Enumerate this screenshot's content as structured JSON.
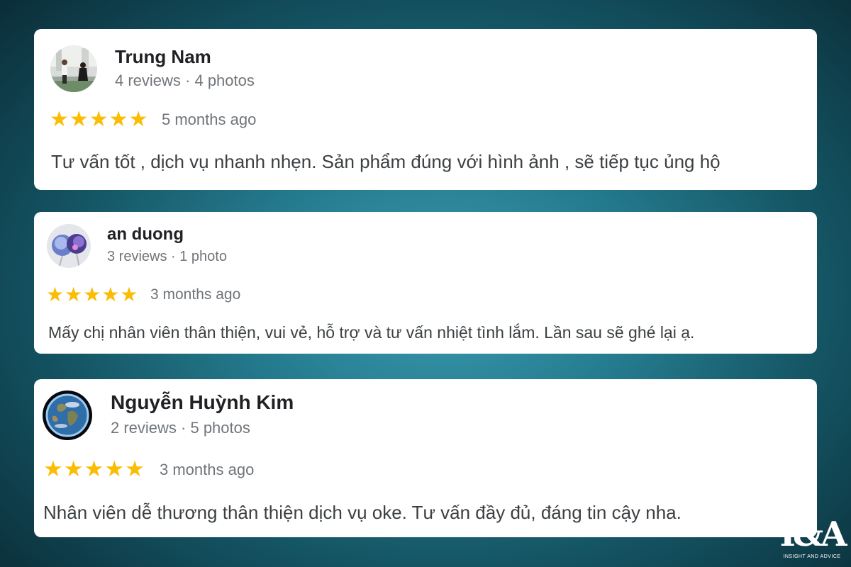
{
  "reviews": [
    {
      "name": "Trung Nam",
      "meta": "4 reviews · 4 photos",
      "stars": "★★★★★",
      "rating": 5,
      "time": "5 months ago",
      "text": "Tư vấn tốt , dịch vụ nhanh nhẹn. Sản phẩm đúng với hình ảnh , sẽ tiếp tục ủng hộ"
    },
    {
      "name": "an duong",
      "meta": "3 reviews · 1 photo",
      "stars": "★★★★★",
      "rating": 5,
      "time": "3 months ago",
      "text": "Mấy chị nhân viên thân thiện, vui vẻ, hỗ trợ và tư vấn nhiệt tình lắm. Lần sau sẽ ghé lại ạ."
    },
    {
      "name": "Nguyễn Huỳnh Kim",
      "meta": "2 reviews · 5 photos",
      "stars": "★★★★★",
      "rating": 5,
      "time": "3 months ago",
      "text": "Nhân viên dễ thương thân thiện dịch vụ oke. Tư vấn đầy đủ, đáng tin cậy nha."
    }
  ],
  "logo": {
    "mark": "I&A",
    "subtitle": "INSIGHT AND ADVICE"
  },
  "colors": {
    "star": "#fbbc04",
    "card": "#ffffff",
    "background": "#24798c"
  }
}
